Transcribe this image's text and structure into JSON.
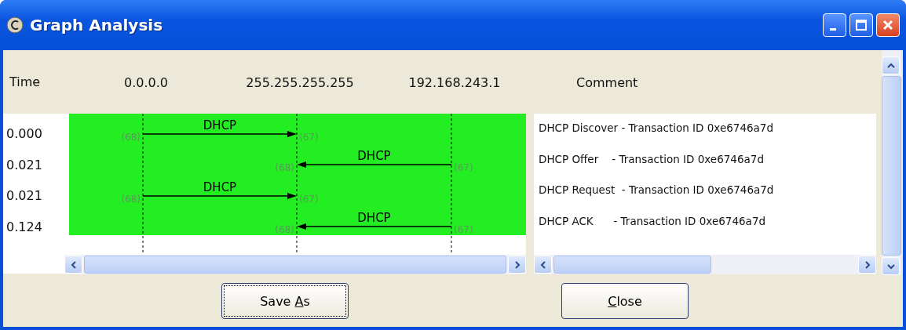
{
  "window": {
    "title": "Graph Analysis"
  },
  "header": {
    "time_label": "Time",
    "nodes": [
      "0.0.0.0",
      "255.255.255.255",
      "192.168.243.1"
    ],
    "comment_label": "Comment"
  },
  "messages": [
    {
      "time": "0.000",
      "kind": "right",
      "label": "DHCP",
      "source_port": "(68)",
      "dest_port": "(67)",
      "comment": "DHCP Discover - Transaction ID 0xe6746a7d"
    },
    {
      "time": "0.021",
      "kind": "left",
      "label": "DHCP",
      "source_port": "(67)",
      "dest_port": "(68)",
      "comment": "DHCP Offer    - Transaction ID 0xe6746a7d"
    },
    {
      "time": "0.021",
      "kind": "right",
      "label": "DHCP",
      "source_port": "(68)",
      "dest_port": "(67)",
      "comment": "DHCP Request  - Transaction ID 0xe6746a7d"
    },
    {
      "time": "0.124",
      "kind": "left",
      "label": "DHCP",
      "source_port": "(67)",
      "dest_port": "(68)",
      "comment": "DHCP ACK      - Transaction ID 0xe6746a7d"
    }
  ],
  "buttons": [
    {
      "text_before": "Save ",
      "access_key": "A",
      "text_after": "s",
      "focused": true
    },
    {
      "access_key": "C",
      "text_after": "lose",
      "focused": false
    }
  ]
}
